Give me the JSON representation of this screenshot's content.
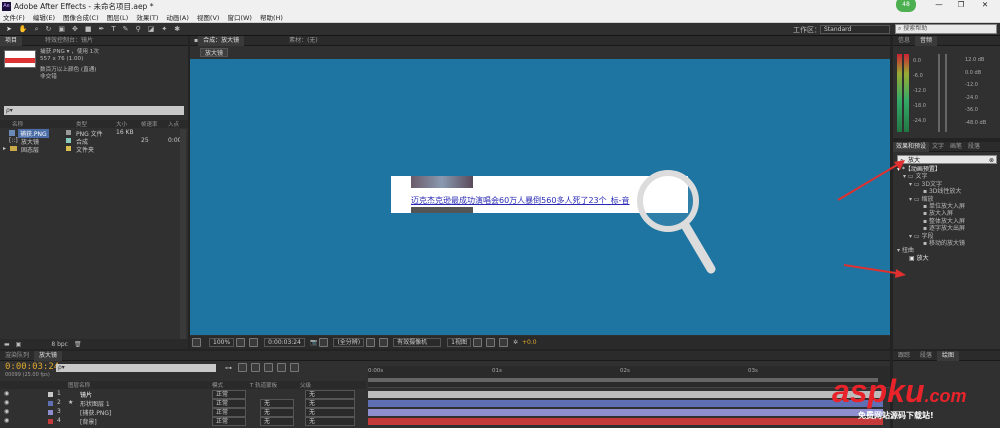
{
  "window": {
    "title": "Adobe After Effects - 未命名项目.aep *",
    "badge": "48"
  },
  "menu": [
    "文件(F)",
    "编辑(E)",
    "图像合成(C)",
    "图层(L)",
    "效果(T)",
    "动画(A)",
    "视图(V)",
    "窗口(W)",
    "帮助(H)"
  ],
  "toolbar": {
    "workspace_label": "工作区：",
    "workspace_value": "Standard",
    "search_placeholder": "搜索帮助"
  },
  "project": {
    "tabs": [
      "项目",
      "特效控制台：镜片"
    ],
    "thumb_name": "捕获.PNG ▾ ，使用 1次",
    "thumb_dims": "557 x 76 (1.00)",
    "thumb_color": "数百万以上颜色 (直通)",
    "thumb_alpha": "非交错",
    "search_placeholder": "ρ▾",
    "columns": [
      "名称",
      "类型",
      "大小",
      "帧速率",
      "入点"
    ],
    "rows": [
      {
        "name": "捕获.PNG",
        "type": "PNG 文件",
        "size": "16 KB",
        "fps": "",
        "in": ""
      },
      {
        "name": "放大镜",
        "type": "合成",
        "size": "",
        "fps": "25",
        "in": "0:00"
      },
      {
        "name": "固态层",
        "type": "文件夹",
        "size": "",
        "fps": "",
        "in": ""
      }
    ],
    "footer": "8 bpc"
  },
  "viewer": {
    "tab_label": "合成：放大镜",
    "tab2_label": "素材：(无)",
    "chip_label": "放大镜",
    "headline": "迈克杰克逊最成功演唱会60万人暴倒560多人死了23个_标-音",
    "bottom_bar": [
      "100%",
      "0:00:03:24",
      "(全分辨)",
      "有效摄像机",
      "1视图",
      "+0.0"
    ],
    "bg_color": "#1e75a2"
  },
  "info": {
    "tabs": [
      "信息",
      "音频"
    ],
    "db_left": [
      "0.0",
      "-6.0",
      "-12.0",
      "-18.0",
      "-24.0"
    ],
    "db_right": [
      "12.0 dB",
      "0.0 dB",
      "-12.0",
      "-24.0",
      "-36.0",
      "-48.0 dB"
    ]
  },
  "effects": {
    "tabs": [
      "效果和预设",
      "文字",
      "画笔",
      "段落"
    ],
    "search_value": "放大",
    "tree": [
      {
        "level": 0,
        "label": "*【动画预置】",
        "hl": true
      },
      {
        "level": 1,
        "label": "文字"
      },
      {
        "level": 2,
        "label": "3D文字"
      },
      {
        "level": 3,
        "label": "3D线性放大"
      },
      {
        "level": 2,
        "label": "缩放"
      },
      {
        "level": 3,
        "label": "单位放大入屏"
      },
      {
        "level": 3,
        "label": "放大入屏"
      },
      {
        "level": 3,
        "label": "整体放大入屏"
      },
      {
        "level": 3,
        "label": "逐字放大出屏"
      },
      {
        "level": 2,
        "label": "字段"
      },
      {
        "level": 3,
        "label": "移动的放大镜"
      },
      {
        "level": 0,
        "label": "扭曲"
      },
      {
        "level": 1,
        "label": "放大",
        "hl": true
      }
    ]
  },
  "bottom_right_tabs": [
    "跟踪",
    "段落",
    "绘图"
  ],
  "timeline": {
    "tabs": [
      "渲染队列",
      "放大镜"
    ],
    "timecode": "0:00:03:24",
    "timecode_sub": "00099 (25.00 fps)",
    "search_placeholder": "ρ▾",
    "columns": [
      "图层名称",
      "模式",
      "T 轨道蒙板",
      "父级"
    ],
    "ruler": [
      "0:00s",
      "01s",
      "02s",
      "03s"
    ],
    "layers": [
      {
        "num": "1",
        "name": "镜片",
        "mode": "正常",
        "trk": "",
        "parent": "无",
        "color": "#c8c8c8"
      },
      {
        "num": "2",
        "name": "形状图层 1",
        "mode": "正常",
        "trk": "无",
        "parent": "无",
        "color": "#5f6fb3"
      },
      {
        "num": "3",
        "name": "[捕获.PNG]",
        "mode": "正常",
        "trk": "无",
        "parent": "无",
        "color": "#8f8fcf"
      },
      {
        "num": "4",
        "name": "[背景]",
        "mode": "正常",
        "trk": "无",
        "parent": "无",
        "color": "#c43a3a"
      }
    ]
  },
  "watermark": {
    "brand": "aspku",
    "domain": ".com",
    "tagline": "免费网站源码下载站!"
  }
}
